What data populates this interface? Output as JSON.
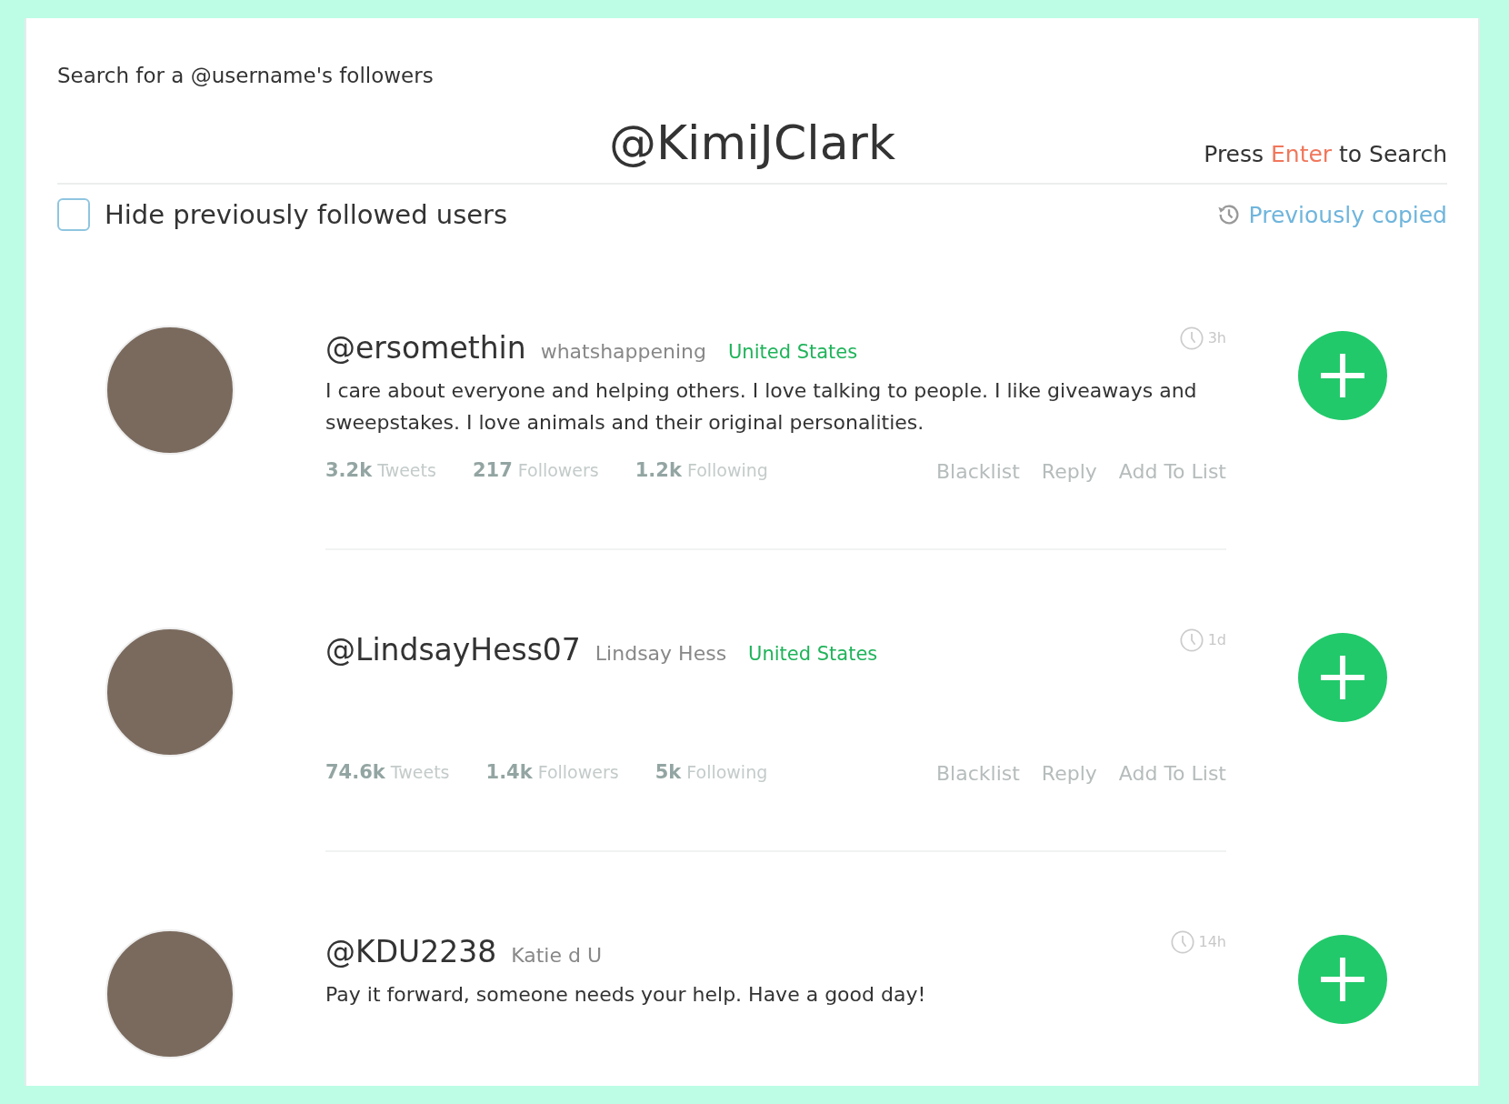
{
  "search_label": "Search for a @username's followers",
  "query": "@KimiJClark",
  "hint": "Press **Enter** to Search",
  "hide_followed": {
    "label": "Hide previously followed users",
    "checked": false
  },
  "history_link": "Previously copied",
  "users": [
    {
      "handle": "@ersomethin",
      "name": "whatshappening",
      "location": "United States",
      "age": "3h",
      "bio": "I care about everyone and helping others. I love talking to people. I like giveaways and sweepstakes. I love animals and their original personalities.",
      "stats": [
        {
          "value": "3.2k",
          "label": "Tweets"
        },
        {
          "value": "217",
          "label": "Followers"
        },
        {
          "value": "1.2k",
          "label": "Following"
        }
      ],
      "actions": [
        "Blacklist",
        "Reply",
        "Add To List"
      ]
    },
    {
      "handle": "@LindsayHess07",
      "name": "Lindsay Hess",
      "location": "United States",
      "age": "1d",
      "stats": [
        {
          "value": "74.6k",
          "label": "Tweets"
        },
        {
          "value": "1.4k",
          "label": "Followers"
        },
        {
          "value": "5k",
          "label": "Following"
        }
      ],
      "actions": [
        "Blacklist",
        "Reply",
        "Add To List"
      ]
    },
    {
      "handle": "@KDU2238",
      "name": "Katie d U",
      "age": "14h",
      "bio": "Pay it forward, someone needs your help. Have a good day!"
    }
  ]
}
